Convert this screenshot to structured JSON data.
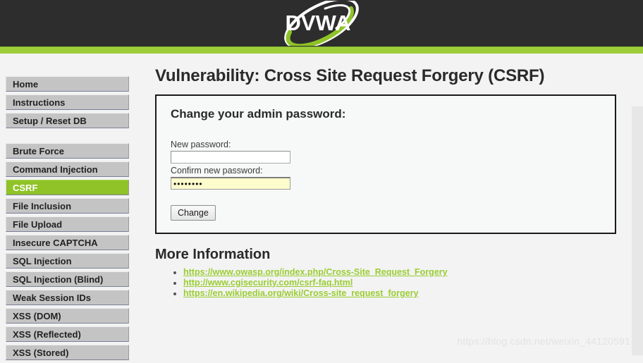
{
  "header": {
    "logo_text": "DVWA",
    "logo_alt": "dvwa-logo",
    "background_color": "#2d2d2d",
    "accent_bar_color": "#9dcc3a"
  },
  "sidebar": {
    "groups": [
      {
        "items": [
          {
            "label": "Home",
            "selected": false
          },
          {
            "label": "Instructions",
            "selected": false
          },
          {
            "label": "Setup / Reset DB",
            "selected": false
          }
        ]
      },
      {
        "items": [
          {
            "label": "Brute Force",
            "selected": false
          },
          {
            "label": "Command Injection",
            "selected": false
          },
          {
            "label": "CSRF",
            "selected": true
          },
          {
            "label": "File Inclusion",
            "selected": false
          },
          {
            "label": "File Upload",
            "selected": false
          },
          {
            "label": "Insecure CAPTCHA",
            "selected": false
          },
          {
            "label": "SQL Injection",
            "selected": false
          },
          {
            "label": "SQL Injection (Blind)",
            "selected": false
          },
          {
            "label": "Weak Session IDs",
            "selected": false
          },
          {
            "label": "XSS (DOM)",
            "selected": false
          },
          {
            "label": "XSS (Reflected)",
            "selected": false
          },
          {
            "label": "XSS (Stored)",
            "selected": false
          }
        ]
      }
    ],
    "selected_color": "#8fc327",
    "item_color": "#c4c4c4"
  },
  "main": {
    "page_title": "Vulnerability: Cross Site Request Forgery (CSRF)",
    "form": {
      "heading": "Change your admin password:",
      "new_password_label": "New password:",
      "new_password_value": "",
      "new_password_placeholder": "",
      "confirm_password_label": "Confirm new password:",
      "confirm_password_value": "••••••••",
      "confirm_password_placeholder": "",
      "submit_label": "Change"
    },
    "more_information": {
      "heading": "More Information",
      "links": [
        "https://www.owasp.org/index.php/Cross-Site_Request_Forgery",
        "http://www.cgisecurity.com/csrf-faq.html",
        "https://en.wikipedia.org/wiki/Cross-site_request_forgery"
      ],
      "link_color": "#9acd32"
    }
  },
  "watermark": {
    "text": "https://blog.csdn.net/weixin_44120591"
  }
}
